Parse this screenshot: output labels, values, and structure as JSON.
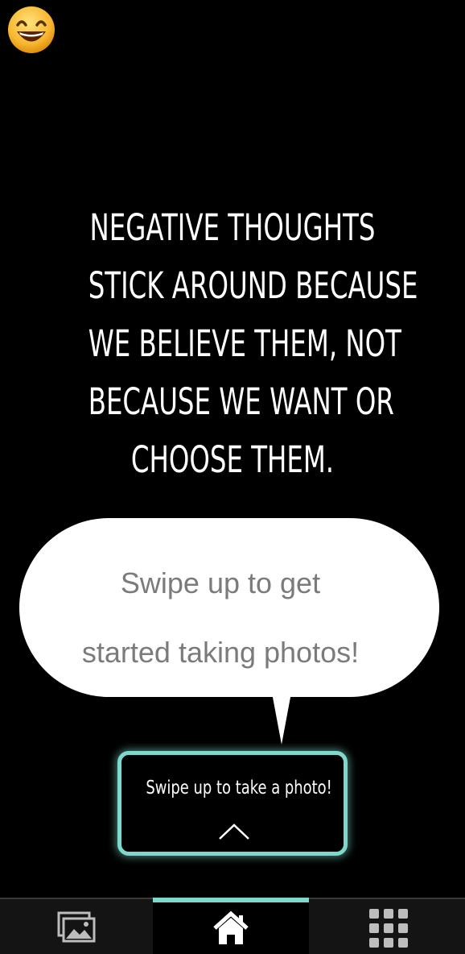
{
  "header": {
    "mood_icon": "smiling-face-icon"
  },
  "quote": {
    "lines": [
      "NEGATIVE THOUGHTS",
      "STICK AROUND BECAUSE",
      "WE BELIEVE THEM, NOT",
      "BECAUSE WE WANT OR",
      "CHOOSE THEM."
    ]
  },
  "tooltip": {
    "lines": [
      "Swipe up to get",
      "started taking photos!"
    ]
  },
  "photo_prompt": {
    "label": "Swipe up to take a photo!",
    "icon": "chevron-up-icon"
  },
  "tabbar": {
    "tabs": [
      {
        "icon": "gallery-icon",
        "active": false
      },
      {
        "icon": "home-icon",
        "active": true
      },
      {
        "icon": "grid-menu-icon",
        "active": false
      }
    ]
  },
  "colors": {
    "accent": "#7fd8cc",
    "background": "#000000",
    "bubble": "#ffffff",
    "bubble_text": "#7b7b7b"
  }
}
